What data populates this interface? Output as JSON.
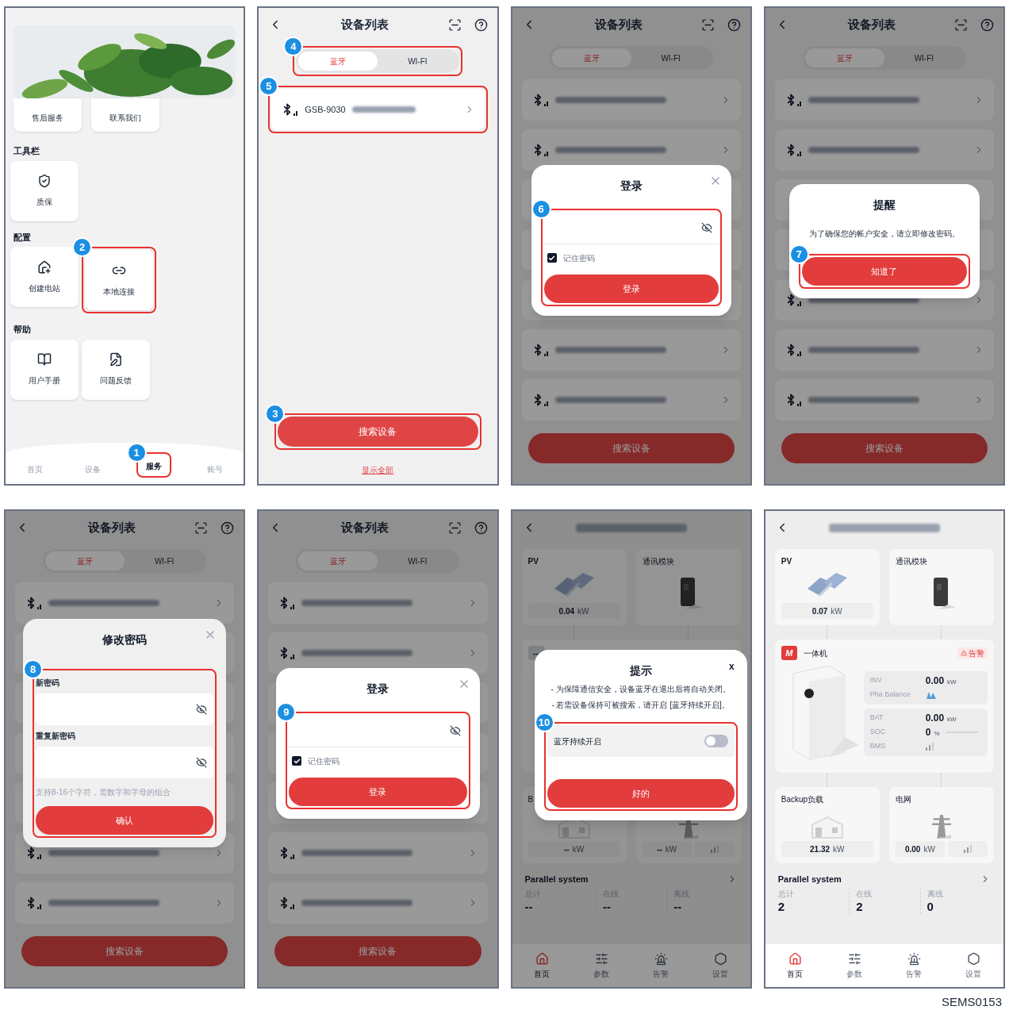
{
  "phones": [
    {
      "kind": "service",
      "top_tiles": [
        "售后服务",
        "联系我们"
      ],
      "sections": [
        {
          "title": "工具栏",
          "tiles": [
            {
              "label": "质保"
            }
          ]
        },
        {
          "title": "配置",
          "tiles": [
            {
              "label": "创建电站"
            },
            {
              "label": "本地连接",
              "step": "2"
            }
          ]
        },
        {
          "title": "帮助",
          "tiles": [
            {
              "label": "用户手册"
            },
            {
              "label": "问题反馈"
            }
          ]
        }
      ],
      "tabbar": [
        {
          "label": "首页",
          "selected": false
        },
        {
          "label": "设备",
          "selected": false
        },
        {
          "label": "服务",
          "selected": true,
          "step": "1"
        },
        {
          "label": "账号",
          "selected": false
        }
      ]
    },
    {
      "kind": "device_list",
      "title": "设备列表",
      "tabs": [
        {
          "label": "蓝牙",
          "selected": true
        },
        {
          "label": "WI-FI",
          "selected": false
        }
      ],
      "tabs_step": "4",
      "devices": [
        {
          "kind": "row",
          "name": "GSB-9030",
          "step": "5"
        }
      ],
      "search_button": "搜索设备",
      "search_step": "3",
      "show_all": "显示全部"
    },
    {
      "kind": "device_list",
      "title": "设备列表",
      "tabs": [
        {
          "label": "蓝牙",
          "selected": true
        },
        {
          "label": "WI-FI",
          "selected": false
        }
      ],
      "devices": [
        {
          "kind": "row"
        },
        {
          "kind": "row"
        },
        {
          "kind": "covered"
        },
        {
          "kind": "covered"
        },
        {
          "kind": "covered"
        },
        {
          "kind": "row"
        },
        {
          "kind": "row"
        }
      ],
      "search_button": "搜索设备",
      "dialog": {
        "kind": "login",
        "title": "登录",
        "remember_label": "记住密码",
        "remember_checked": true,
        "button": "登录",
        "step": "6"
      }
    },
    {
      "kind": "device_list",
      "title": "设备列表",
      "tabs": [
        {
          "label": "蓝牙",
          "selected": true
        },
        {
          "label": "WI-FI",
          "selected": false
        }
      ],
      "devices": [
        {
          "kind": "row"
        },
        {
          "kind": "row"
        },
        {
          "kind": "covered"
        },
        {
          "kind": "covered"
        },
        {
          "kind": "row"
        },
        {
          "kind": "row"
        },
        {
          "kind": "row"
        }
      ],
      "search_button": "搜索设备",
      "dialog": {
        "kind": "notice",
        "title": "提醒",
        "message": "为了确保您的帐户安全，请立即修改密码。",
        "button": "知道了",
        "step": "7"
      }
    },
    {
      "kind": "device_list",
      "title": "设备列表",
      "tabs": [
        {
          "label": "蓝牙",
          "selected": true
        },
        {
          "label": "WI-FI",
          "selected": false
        }
      ],
      "devices": [
        {
          "kind": "row"
        },
        {
          "kind": "covered"
        },
        {
          "kind": "covered"
        },
        {
          "kind": "covered"
        },
        {
          "kind": "covered"
        },
        {
          "kind": "row"
        },
        {
          "kind": "row"
        }
      ],
      "search_button": "搜索设备",
      "dialog": {
        "kind": "change_password",
        "title": "修改密码",
        "fields": [
          {
            "label": "新密码"
          },
          {
            "label": "重复新密码"
          }
        ],
        "hint": "支持8-16个字符，需数字和字母的组合",
        "button": "确认",
        "step": "8"
      }
    },
    {
      "kind": "device_list",
      "title": "设备列表",
      "tabs": [
        {
          "label": "蓝牙",
          "selected": true
        },
        {
          "label": "WI-FI",
          "selected": false
        }
      ],
      "devices": [
        {
          "kind": "row"
        },
        {
          "kind": "row"
        },
        {
          "kind": "covered"
        },
        {
          "kind": "covered"
        },
        {
          "kind": "covered"
        },
        {
          "kind": "row"
        },
        {
          "kind": "row"
        }
      ],
      "search_button": "搜索设备",
      "dialog": {
        "kind": "login",
        "title": "登录",
        "remember_label": "记住密码",
        "remember_checked": true,
        "button": "登录",
        "step": "9"
      }
    },
    {
      "kind": "device_detail",
      "pv": {
        "title": "PV",
        "value": "0.04",
        "unit": "kW"
      },
      "comm": {
        "title": "通讯模块"
      },
      "inverter": {
        "kind": "covered",
        "badge": "--"
      },
      "backup": {
        "title": "B",
        "value": "--",
        "unit": "kW"
      },
      "grid": {
        "value": "--",
        "unit": "kW"
      },
      "parallel": {
        "title": "Parallel system",
        "stats": [
          {
            "label": "总计",
            "value": "--"
          },
          {
            "label": "在线",
            "value": "--"
          },
          {
            "label": "离线",
            "value": "--"
          }
        ]
      },
      "tabbar": [
        {
          "label": "首页",
          "selected": true
        },
        {
          "label": "参数",
          "selected": false
        },
        {
          "label": "告警",
          "selected": false
        },
        {
          "label": "设置",
          "selected": false
        }
      ],
      "dialog": {
        "kind": "bluetooth_tip",
        "title": "提示",
        "close": "x",
        "lines": [
          "- 为保障通信安全，设备蓝牙在退出后将自动关闭。",
          "- 若需设备保持可被搜索，请开启 [蓝牙持续开启]。"
        ],
        "toggle_label": "蓝牙持续开启",
        "toggle_on": false,
        "button": "好的",
        "step": "10"
      }
    },
    {
      "kind": "device_detail",
      "pv": {
        "title": "PV",
        "value": "0.07",
        "unit": "kW"
      },
      "comm": {
        "title": "通讯模块"
      },
      "inverter": {
        "kind": "full",
        "badge": "M",
        "title": "一体机",
        "alarm": "告警",
        "groups": [
          {
            "rows": [
              {
                "kind": "value",
                "label": "INV",
                "value": "0.00",
                "unit": "kW"
              },
              {
                "kind": "balance",
                "label": "Pha Balance"
              }
            ]
          },
          {
            "rows": [
              {
                "kind": "value",
                "label": "BAT",
                "value": "0.00",
                "unit": "kW"
              },
              {
                "kind": "meter",
                "label": "SOC",
                "value": "0",
                "unit": "%",
                "level": 0
              },
              {
                "kind": "signal",
                "label": "BMS"
              }
            ]
          }
        ]
      },
      "backup": {
        "title": "Backup负载",
        "value": "21.32",
        "unit": "kW"
      },
      "grid": {
        "title": "电网",
        "value": "0.00",
        "unit": "kW"
      },
      "parallel": {
        "title": "Parallel system",
        "stats": [
          {
            "label": "总计",
            "value": "2"
          },
          {
            "label": "在线",
            "value": "2"
          },
          {
            "label": "离线",
            "value": "0"
          }
        ]
      },
      "tabbar": [
        {
          "label": "首页",
          "selected": true
        },
        {
          "label": "参数",
          "selected": false
        },
        {
          "label": "告警",
          "selected": false
        },
        {
          "label": "设置",
          "selected": false
        }
      ]
    }
  ],
  "figure_code": "SEMS0153"
}
